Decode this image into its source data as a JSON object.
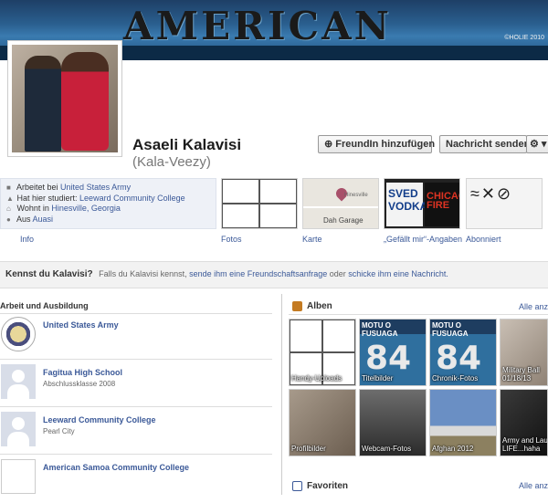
{
  "cover": {
    "title": "AMERICAN SAMOA",
    "credit": "©HOLIE 2010"
  },
  "profile": {
    "name": "Asaeli Kalavisi",
    "alt_name": "(Kala-Veezy)"
  },
  "actions": {
    "add_friend": "FreundIn hinzufügen",
    "send_message": "Nachricht senden"
  },
  "info": {
    "items": [
      {
        "icon": "briefcase-icon",
        "prefix": "Arbeitet bei ",
        "link": "United States Army",
        "suffix": ""
      },
      {
        "icon": "graduation-icon",
        "prefix": "Hat hier studiert: ",
        "link": "Leeward Community College",
        "suffix": ""
      },
      {
        "icon": "home-icon",
        "prefix": "Wohnt in ",
        "link": "Hinesville, Georgia",
        "suffix": ""
      },
      {
        "icon": "pin-icon",
        "prefix": "Aus ",
        "link": "Auasi",
        "suffix": ""
      }
    ],
    "label": "Info"
  },
  "tiles": {
    "photos_label": "Fotos",
    "map_label": "Karte",
    "map_place": "Dah Garage",
    "map_town": "Hinesville",
    "likes_label": "„Gefällt mir“-Angaben",
    "subs_label": "Abonniert",
    "like1_text": "SVED VODKA",
    "like2_text": "CHICAGO FIRE"
  },
  "kennst": {
    "question": "Kennst du Kalavisi?",
    "text1": "Falls du Kalavisi kennst,",
    "link1": "sende ihm eine Freundschaftsanfrage",
    "text2": "oder",
    "link2": "schicke ihm eine Nachricht.",
    "text3": ""
  },
  "work": {
    "heading": "Arbeit und Ausbildung",
    "items": [
      {
        "name": "United States Army",
        "sub": ""
      },
      {
        "name": "Fagitua High School",
        "sub": "Abschlussklasse 2008"
      },
      {
        "name": "Leeward Community College",
        "sub": "Pearl City"
      },
      {
        "name": "American Samoa Community College",
        "sub": ""
      }
    ]
  },
  "albums": {
    "heading": "Alben",
    "all_link": "Alle anze",
    "items": [
      "Handy-Uploads",
      "Titelbilder",
      "Chronik-Fotos",
      "Military Ball 01/18/13",
      "Profilbilder",
      "Webcam-Fotos",
      "Afghan 2012",
      "Army and Lau LIFE...haha"
    ],
    "blue_top": "MOTU O FUSUAGA",
    "blue_number": "84"
  },
  "favorites": {
    "heading": "Favoriten",
    "all_link": "Alle anze"
  },
  "colors": {
    "link": "#3b5998",
    "cover": "#2a5f8f"
  }
}
